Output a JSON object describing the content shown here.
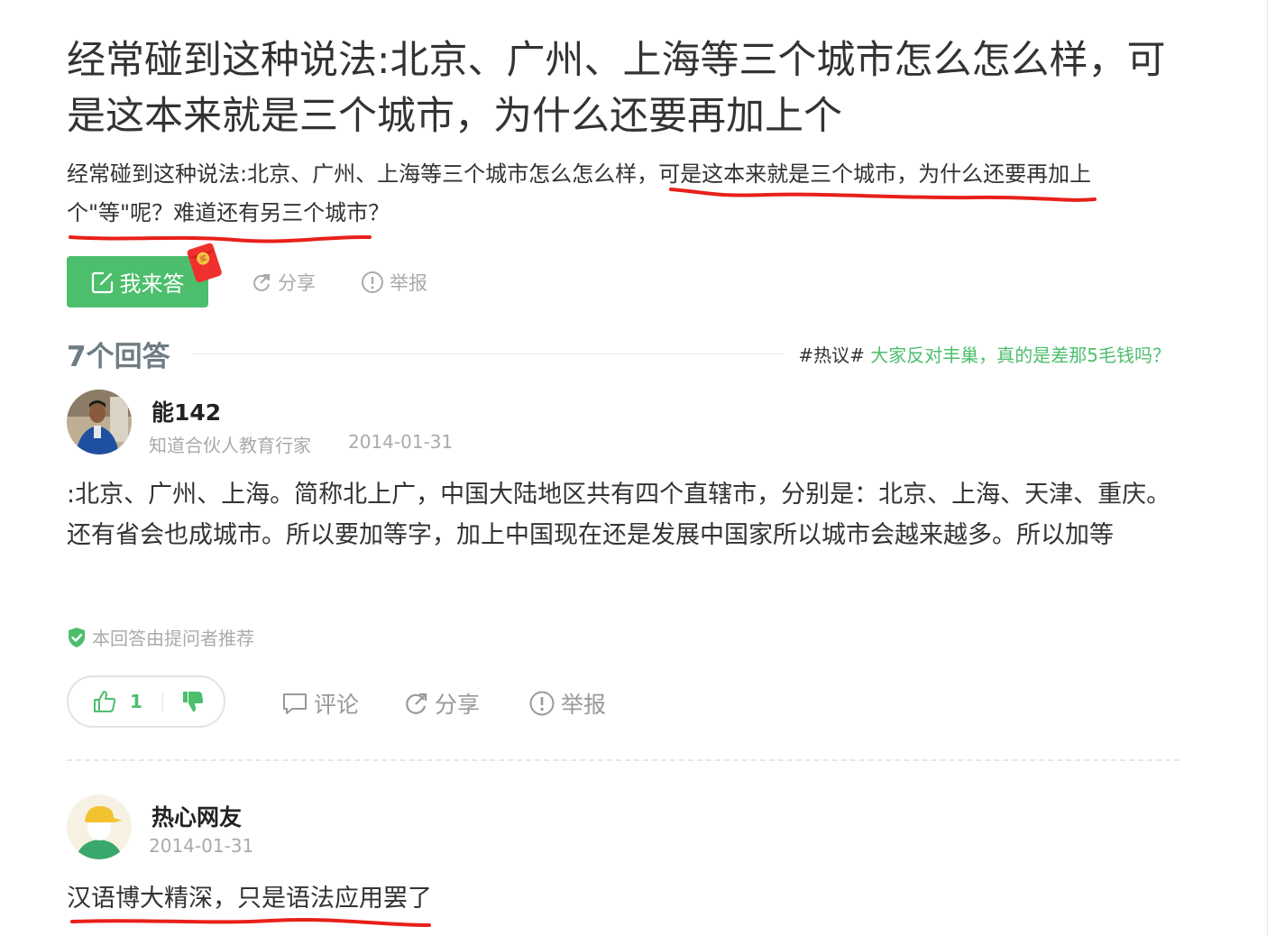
{
  "question": {
    "title": "经常碰到这种说法:北京、广州、上海等三个城市怎么怎么样，可是这本来就是三个城市，为什么还要再加上个",
    "description": "经常碰到这种说法:北京、广州、上海等三个城市怎么怎么样，可是这本来就是三个城市，为什么还要再加上个\"等\"呢？难道还有另三个城市？",
    "answer_button_label": "我来答",
    "share_label": "分享",
    "report_label": "举报",
    "redpacket_char": "奖"
  },
  "answers_header": {
    "count_label": "7个回答",
    "hot_tag": "#热议#",
    "hot_text": "大家反对丰巢，真的是差那5毛钱吗？"
  },
  "answers": [
    {
      "user_name": "能142",
      "user_title": "知道合伙人教育行家",
      "date": "2014-01-31",
      "body": ":北京、广州、上海。简称北上广，中国大陆地区共有四个直辖市，分别是：北京、上海、天津、重庆。还有省会也成城市。所以要加等字，加上中国现在还是发展中国家所以城市会越来越多。所以加等",
      "recommend_label": "本回答由提问者推荐",
      "like_count": "1",
      "comment_label": "评论",
      "share_label": "分享",
      "report_label": "举报"
    },
    {
      "user_name": "热心网友",
      "date": "2014-01-31",
      "body": "汉语博大精深，只是语法应用罢了"
    }
  ],
  "colors": {
    "brand_green": "#4cbe6c",
    "annotation_red": "#e8201a",
    "muted_text": "#aaaaaa"
  },
  "icons": {
    "answer": "edit-icon",
    "share": "share-icon",
    "report": "report-icon",
    "recommend": "shield-check-icon",
    "like": "thumbs-up-icon",
    "dislike": "thumbs-down-icon",
    "comment": "comment-icon",
    "redpacket": "red-packet-icon"
  }
}
